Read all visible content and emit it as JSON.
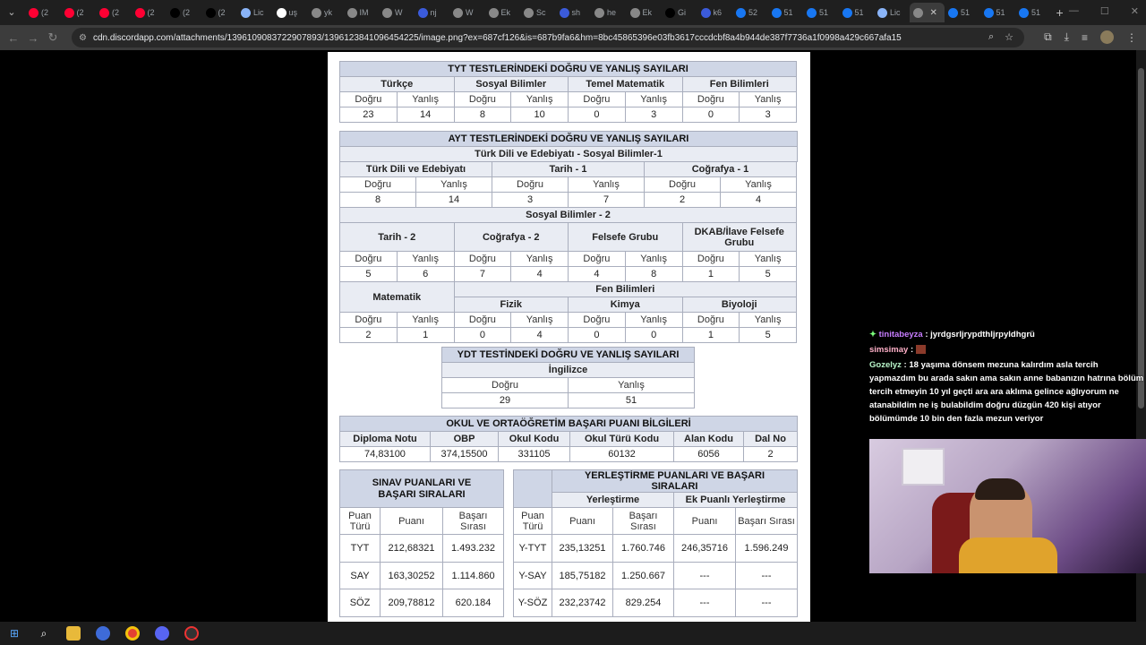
{
  "browser": {
    "tabs": [
      {
        "label": "(2",
        "icon": "youtube-icon",
        "color": "#ff0033"
      },
      {
        "label": "(2",
        "icon": "youtube-icon",
        "color": "#ff0033"
      },
      {
        "label": "(2",
        "icon": "youtube-icon",
        "color": "#ff0033"
      },
      {
        "label": "(2",
        "icon": "youtube-icon",
        "color": "#ff0033"
      },
      {
        "label": "(2",
        "icon": "x-icon",
        "color": "#000000"
      },
      {
        "label": "(2",
        "icon": "x-icon",
        "color": "#000000"
      },
      {
        "label": "Lic",
        "icon": "pen-icon",
        "color": "#8ab4f8"
      },
      {
        "label": "uş",
        "icon": "google-icon",
        "color": "#ffffff"
      },
      {
        "label": "yk",
        "icon": "globe-icon",
        "color": "#888888"
      },
      {
        "label": "IM",
        "icon": "globe-icon",
        "color": "#888888"
      },
      {
        "label": "W",
        "icon": "globe-icon",
        "color": "#888888"
      },
      {
        "label": "nj",
        "icon": "h-icon",
        "color": "#3b5bdb"
      },
      {
        "label": "W",
        "icon": "globe-icon",
        "color": "#888888"
      },
      {
        "label": "Ek",
        "icon": "globe-icon",
        "color": "#888888"
      },
      {
        "label": "Sc",
        "icon": "globe-icon",
        "color": "#888888"
      },
      {
        "label": "sh",
        "icon": "h-icon",
        "color": "#3b5bdb"
      },
      {
        "label": "he",
        "icon": "globe-icon",
        "color": "#888888"
      },
      {
        "label": "Ek",
        "icon": "globe-icon",
        "color": "#888888"
      },
      {
        "label": "Gi",
        "icon": "x-icon",
        "color": "#000000"
      },
      {
        "label": "k6",
        "icon": "h-icon",
        "color": "#3b5bdb"
      },
      {
        "label": "52",
        "icon": "facebook-icon",
        "color": "#1877f2"
      },
      {
        "label": "51",
        "icon": "facebook-icon",
        "color": "#1877f2"
      },
      {
        "label": "51",
        "icon": "facebook-icon",
        "color": "#1877f2"
      },
      {
        "label": "51",
        "icon": "facebook-icon",
        "color": "#1877f2"
      },
      {
        "label": "Lic",
        "icon": "pen-icon",
        "color": "#8ab4f8"
      },
      {
        "label": "",
        "icon": "globe-icon",
        "color": "#888888",
        "active": true
      },
      {
        "label": "51",
        "icon": "facebook-icon",
        "color": "#1877f2"
      },
      {
        "label": "51",
        "icon": "facebook-icon",
        "color": "#1877f2"
      },
      {
        "label": "51",
        "icon": "facebook-icon",
        "color": "#1877f2"
      }
    ],
    "url": "cdn.discordapp.com/attachments/1396109083722907893/1396123841096454225/image.png?ex=687cf126&is=687b9fa6&hm=8bc45865396e03fb3617cccdcbf8a4b944de387f7736a1f0998a429c667afa15"
  },
  "tyt": {
    "title": "TYT TESTLERİNDEKİ DOĞRU VE YANLIŞ SAYILARI",
    "subjects": [
      "Türkçe",
      "Sosyal Bilimler",
      "Temel Matematik",
      "Fen Bilimleri"
    ],
    "dogru": "Doğru",
    "yanlis": "Yanlış",
    "values": [
      "23",
      "14",
      "8",
      "10",
      "0",
      "3",
      "0",
      "3"
    ]
  },
  "ayt": {
    "title": "AYT TESTLERİNDEKİ DOĞRU VE YANLIŞ SAYILARI",
    "section1": "Türk Dili ve Edebiyatı - Sosyal Bilimler-1",
    "s1_subjects": [
      "Türk Dili ve Edebiyatı",
      "Tarih - 1",
      "Coğrafya - 1"
    ],
    "s1_values": [
      "8",
      "14",
      "3",
      "7",
      "2",
      "4"
    ],
    "section2": "Sosyal Bilimler - 2",
    "s2_subjects": [
      "Tarih - 2",
      "Coğrafya - 2",
      "Felsefe Grubu",
      "DKAB/İlave Felsefe Grubu"
    ],
    "s2_values": [
      "5",
      "6",
      "7",
      "4",
      "4",
      "8",
      "1",
      "5"
    ],
    "matematik": "Matematik",
    "fen": "Fen Bilimleri",
    "fen_subjects": [
      "Fizik",
      "Kimya",
      "Biyoloji"
    ],
    "s3_values": [
      "2",
      "1",
      "0",
      "4",
      "0",
      "0",
      "1",
      "5"
    ]
  },
  "ydt": {
    "title": "YDT TESTİNDEKİ DOĞRU VE YANLIŞ SAYILARI",
    "subject": "İngilizce",
    "values": [
      "29",
      "51"
    ]
  },
  "okul": {
    "title": "OKUL VE ORTAÖĞRETİM BAŞARI PUANI BİLGİLERİ",
    "headers": [
      "Diploma Notu",
      "OBP",
      "Okul Kodu",
      "Okul Türü Kodu",
      "Alan Kodu",
      "Dal No"
    ],
    "values": [
      "74,83100",
      "374,15500",
      "331105",
      "60132",
      "6056",
      "2"
    ]
  },
  "sinav": {
    "title": "SINAV PUANLARI VE BAŞARI SIRALARI",
    "headers": [
      "Puan Türü",
      "Puanı",
      "Başarı Sırası"
    ],
    "rows": [
      [
        "TYT",
        "212,68321",
        "1.493.232"
      ],
      [
        "SAY",
        "163,30252",
        "1.114.860"
      ],
      [
        "SÖZ",
        "209,78812",
        "620.184"
      ]
    ]
  },
  "yerlestirme": {
    "title": "YERLEŞTİRME PUANLARI VE BAŞARI SIRALARI",
    "group1": "Yerleştirme",
    "group2": "Ek Puanlı Yerleştirme",
    "headers": [
      "Puan Türü",
      "Puanı",
      "Başarı Sırası",
      "Puanı",
      "Başarı Sırası"
    ],
    "rows": [
      [
        "Y-TYT",
        "235,13251",
        "1.760.746",
        "246,35716",
        "1.596.249"
      ],
      [
        "Y-SAY",
        "185,75182",
        "1.250.667",
        "---",
        "---"
      ],
      [
        "Y-SÖZ",
        "232,23742",
        "829.254",
        "---",
        "---"
      ]
    ]
  },
  "chat": [
    {
      "user": "tinitabeyza",
      "text": "jyrdgsrljrypdthljrpyldhgrü"
    },
    {
      "user": "simsimay",
      "text": ""
    },
    {
      "user": "Gozelyz",
      "text": "18 yaşıma dönsem mezuna kalırdım asla tercih yapmazdım bu arada sakın ama sakın anne babanızın hatrına bölüm tercih etmeyin 10 yıl geçti ara ara aklıma gelince ağlıyorum ne atanabildim ne iş bulabildim doğru düzgün 420 kişi atıyor bölümümde 10 bin den fazla mezun veriyor"
    }
  ],
  "colors": {
    "header": "#cfd6e6",
    "border": "#a9aebd",
    "page": "#ffffff",
    "background": "#000000"
  }
}
